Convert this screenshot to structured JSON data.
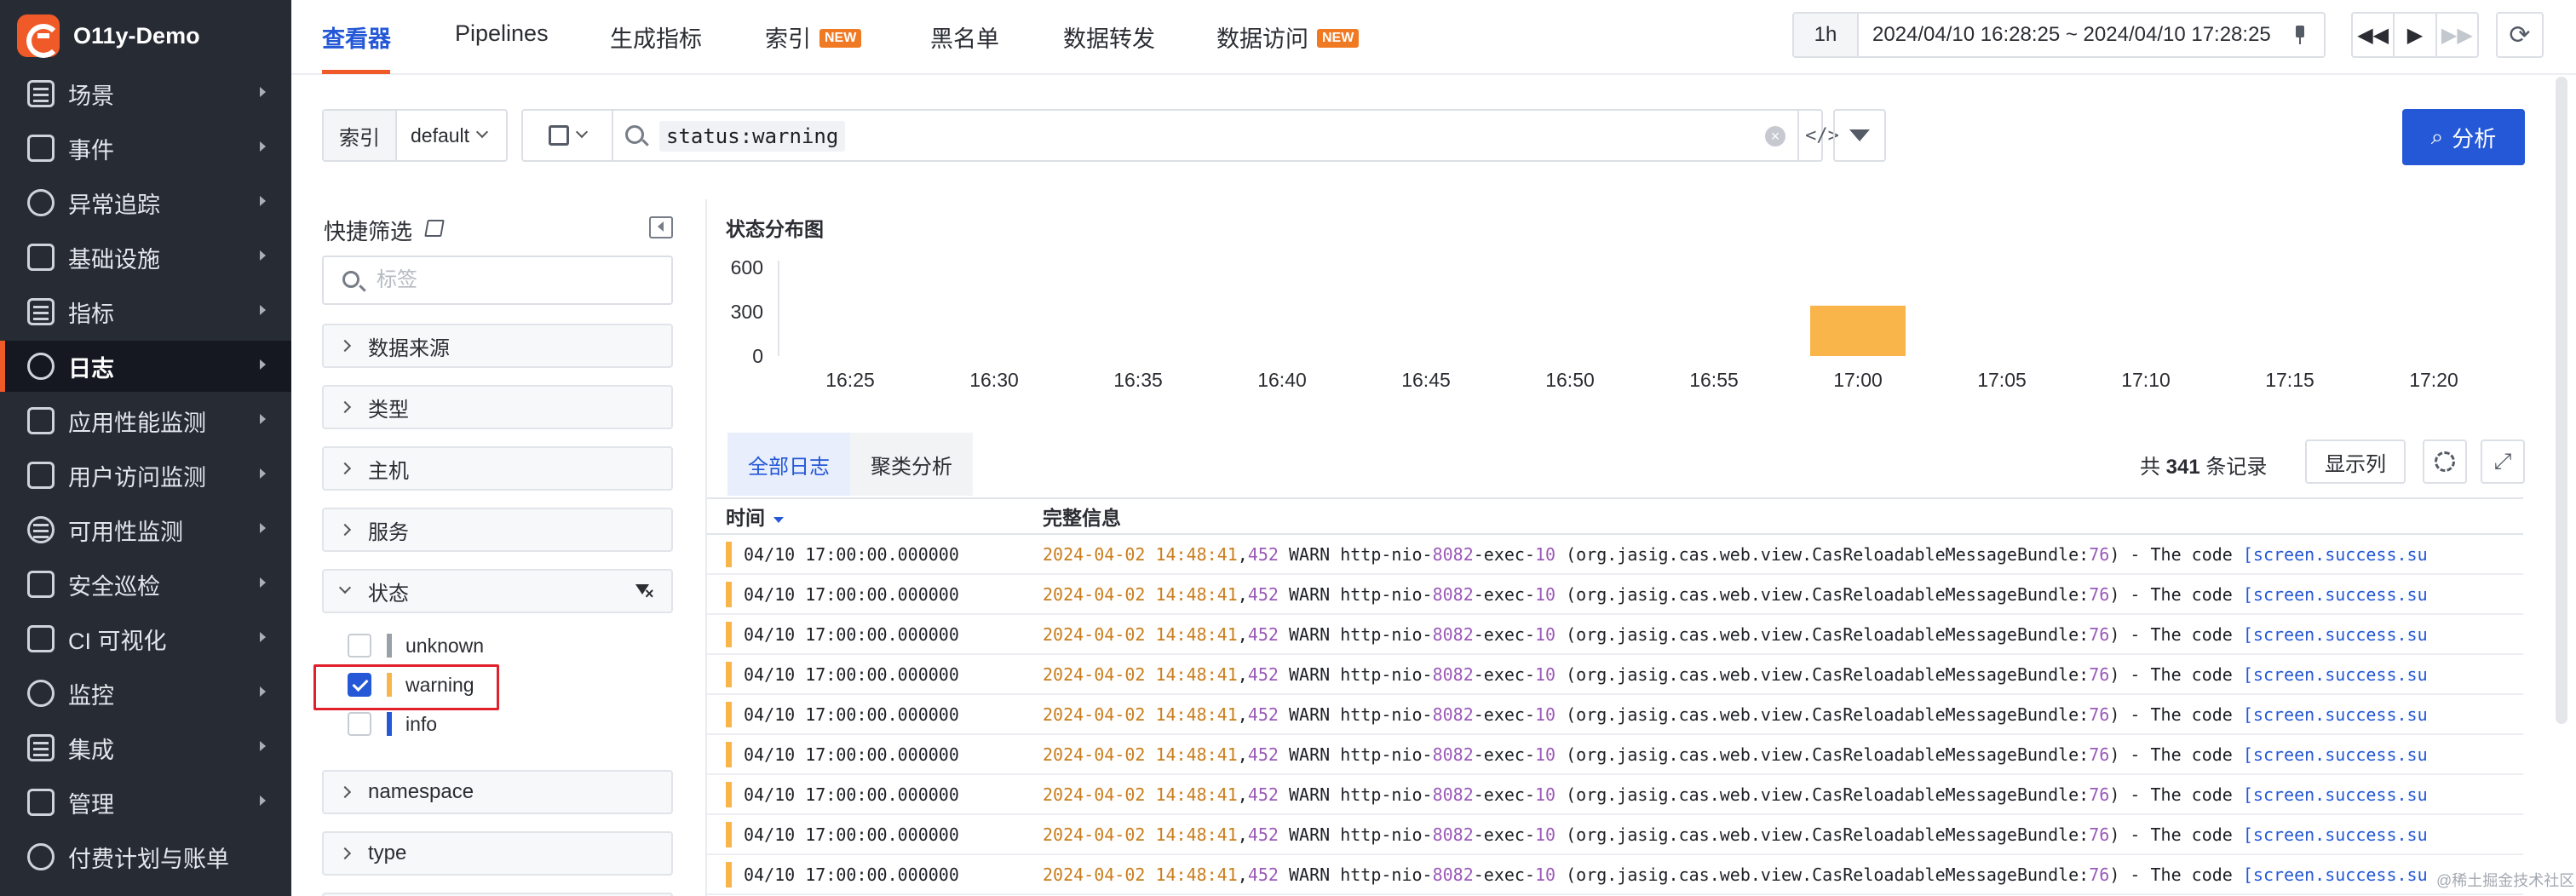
{
  "app": {
    "title": "O11y-Demo"
  },
  "sidebar": {
    "items": [
      {
        "label": "场景",
        "icon": "monitor-icon"
      },
      {
        "label": "事件",
        "icon": "calendar-icon"
      },
      {
        "label": "异常追踪",
        "icon": "target-icon"
      },
      {
        "label": "基础设施",
        "icon": "cluster-icon"
      },
      {
        "label": "指标",
        "icon": "chart-icon"
      },
      {
        "label": "日志",
        "icon": "log-search-icon",
        "active": true
      },
      {
        "label": "应用性能监测",
        "icon": "list-icon"
      },
      {
        "label": "用户访问监测",
        "icon": "grid-icon"
      },
      {
        "label": "可用性监测",
        "icon": "no-icon"
      },
      {
        "label": "安全巡检",
        "icon": "shield-icon"
      },
      {
        "label": "CI 可视化",
        "icon": "ci-icon"
      },
      {
        "label": "监控",
        "icon": "monitor-bell-icon"
      },
      {
        "label": "集成",
        "icon": "hex-icon"
      },
      {
        "label": "管理",
        "icon": "sliders-icon"
      },
      {
        "label": "付费计划与账单",
        "icon": "bill-icon"
      }
    ]
  },
  "topnav": {
    "tabs": [
      {
        "label": "查看器",
        "active": true
      },
      {
        "label": "Pipelines"
      },
      {
        "label": "生成指标"
      },
      {
        "label": "索引",
        "badge": "NEW"
      },
      {
        "label": "黑名单"
      },
      {
        "label": "数据转发"
      },
      {
        "label": "数据访问",
        "badge": "NEW"
      }
    ]
  },
  "timepicker": {
    "preset": "1h",
    "range": "2024/04/10 16:28:25 ~ 2024/04/10 17:28:25"
  },
  "search": {
    "index_label": "索引",
    "index_value": "default",
    "query": "status:warning",
    "analyze_label": "分析"
  },
  "quickfilter": {
    "title": "快捷筛选",
    "tag_placeholder": "标签",
    "facets": [
      "数据来源",
      "类型",
      "主机",
      "服务"
    ],
    "status_facet": "状态",
    "status_options": [
      {
        "label": "unknown",
        "color": "#9aa0a8",
        "checked": false
      },
      {
        "label": "warning",
        "color": "#f9b54a",
        "checked": true
      },
      {
        "label": "info",
        "color": "#2458d6",
        "checked": false
      }
    ],
    "more_facets": [
      "namespace",
      "type"
    ]
  },
  "chart_data": {
    "type": "bar",
    "title": "状态分布图",
    "x_ticks": [
      "16:25",
      "16:30",
      "16:35",
      "16:40",
      "16:45",
      "16:50",
      "16:55",
      "17:00",
      "17:05",
      "17:10",
      "17:15",
      "17:20"
    ],
    "y_ticks": [
      0,
      300,
      600
    ],
    "ylim": [
      0,
      600
    ],
    "series": [
      {
        "name": "warning",
        "color": "#f9b54a",
        "points": [
          {
            "x": "17:00",
            "value": 341
          }
        ]
      }
    ]
  },
  "logs": {
    "tabs": [
      {
        "label": "全部日志",
        "active": true
      },
      {
        "label": "聚类分析"
      }
    ],
    "count_prefix": "共 ",
    "count_value": "341",
    "count_suffix": " 条记录",
    "columns_button": "显示列",
    "col_time": "时间",
    "col_message": "完整信息",
    "rows": [
      {
        "time": "04/10 17:00:00.000000",
        "date": "2024-04-02 14:48:41",
        "ms": "452",
        "pre": " WARN http-nio-",
        "port": "8082",
        "mid": "-exec-",
        "thread": "10",
        "cls": " (org.jasig.cas.web.view.CasReloadableMessageBundle:",
        "line": "76",
        "post": ") - The code ",
        "link": "[screen.success.su"
      },
      {
        "time": "04/10 17:00:00.000000",
        "date": "2024-04-02 14:48:41",
        "ms": "452",
        "pre": " WARN http-nio-",
        "port": "8082",
        "mid": "-exec-",
        "thread": "10",
        "cls": " (org.jasig.cas.web.view.CasReloadableMessageBundle:",
        "line": "76",
        "post": ") - The code ",
        "link": "[screen.success.su"
      },
      {
        "time": "04/10 17:00:00.000000",
        "date": "2024-04-02 14:48:41",
        "ms": "452",
        "pre": " WARN http-nio-",
        "port": "8082",
        "mid": "-exec-",
        "thread": "10",
        "cls": " (org.jasig.cas.web.view.CasReloadableMessageBundle:",
        "line": "76",
        "post": ") - The code ",
        "link": "[screen.success.su"
      },
      {
        "time": "04/10 17:00:00.000000",
        "date": "2024-04-02 14:48:41",
        "ms": "452",
        "pre": " WARN http-nio-",
        "port": "8082",
        "mid": "-exec-",
        "thread": "10",
        "cls": " (org.jasig.cas.web.view.CasReloadableMessageBundle:",
        "line": "76",
        "post": ") - The code ",
        "link": "[screen.success.su"
      },
      {
        "time": "04/10 17:00:00.000000",
        "date": "2024-04-02 14:48:41",
        "ms": "452",
        "pre": " WARN http-nio-",
        "port": "8082",
        "mid": "-exec-",
        "thread": "10",
        "cls": " (org.jasig.cas.web.view.CasReloadableMessageBundle:",
        "line": "76",
        "post": ") - The code ",
        "link": "[screen.success.su"
      },
      {
        "time": "04/10 17:00:00.000000",
        "date": "2024-04-02 14:48:41",
        "ms": "452",
        "pre": " WARN http-nio-",
        "port": "8082",
        "mid": "-exec-",
        "thread": "10",
        "cls": " (org.jasig.cas.web.view.CasReloadableMessageBundle:",
        "line": "76",
        "post": ") - The code ",
        "link": "[screen.success.su"
      },
      {
        "time": "04/10 17:00:00.000000",
        "date": "2024-04-02 14:48:41",
        "ms": "452",
        "pre": " WARN http-nio-",
        "port": "8082",
        "mid": "-exec-",
        "thread": "10",
        "cls": " (org.jasig.cas.web.view.CasReloadableMessageBundle:",
        "line": "76",
        "post": ") - The code ",
        "link": "[screen.success.su"
      },
      {
        "time": "04/10 17:00:00.000000",
        "date": "2024-04-02 14:48:41",
        "ms": "452",
        "pre": " WARN http-nio-",
        "port": "8082",
        "mid": "-exec-",
        "thread": "10",
        "cls": " (org.jasig.cas.web.view.CasReloadableMessageBundle:",
        "line": "76",
        "post": ") - The code ",
        "link": "[screen.success.su"
      },
      {
        "time": "04/10 17:00:00.000000",
        "date": "2024-04-02 14:48:41",
        "ms": "452",
        "pre": " WARN http-nio-",
        "port": "8082",
        "mid": "-exec-",
        "thread": "10",
        "cls": " (org.jasig.cas.web.view.CasReloadableMessageBundle:",
        "line": "76",
        "post": ") - The code ",
        "link": "[screen.success.su"
      }
    ]
  },
  "watermark": "@稀土掘金技术社区"
}
